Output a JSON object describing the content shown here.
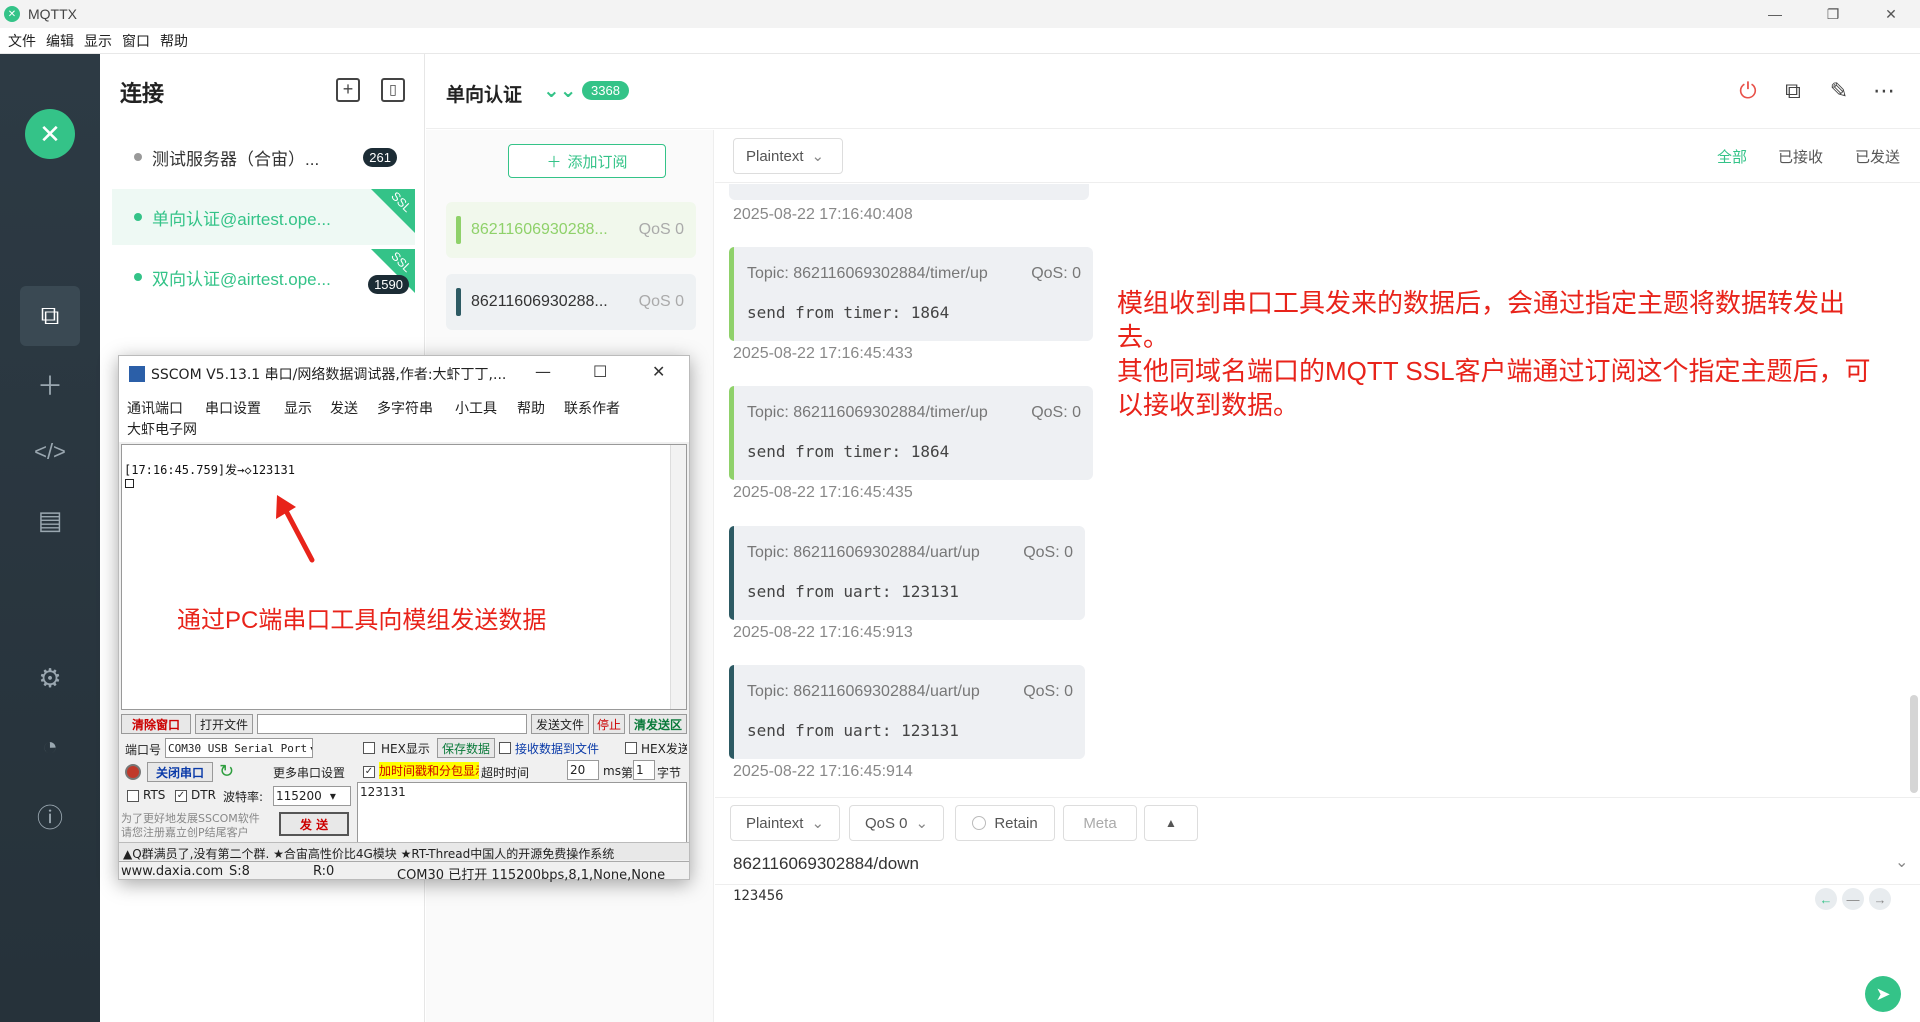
{
  "window": {
    "title": "MQTTX"
  },
  "menubar": [
    "文件",
    "编辑",
    "显示",
    "窗口",
    "帮助"
  ],
  "sidebar_nav": [
    {
      "icon": "connections-icon",
      "active": true
    },
    {
      "icon": "plus-icon",
      "active": false
    },
    {
      "icon": "script-icon",
      "active": false
    },
    {
      "icon": "log-icon",
      "active": false
    },
    {
      "icon": "settings-icon",
      "active": false
    },
    {
      "icon": "subscribe-feed-icon",
      "active": false
    },
    {
      "icon": "about-icon",
      "active": false
    }
  ],
  "connections": {
    "title": "连接",
    "items": [
      {
        "name": "测试服务器（合宙）...",
        "badge": "261",
        "ssl": false,
        "connected": false,
        "active": false
      },
      {
        "name": "单向认证@airtest.ope...",
        "badge": "",
        "ssl": true,
        "connected": true,
        "active": true
      },
      {
        "name": "双向认证@airtest.ope...",
        "badge": "1590",
        "ssl": true,
        "connected": true,
        "active": false
      }
    ],
    "ssl_label": "SSL"
  },
  "header": {
    "title": "单向认证",
    "badge": "3368"
  },
  "topics": {
    "add_label": "添加订阅",
    "items": [
      {
        "topic": "86211606930288...",
        "qos": "QoS 0",
        "color": "#8fd16a"
      },
      {
        "topic": "86211606930288...",
        "qos": "QoS 0",
        "color": "#2d5a63"
      }
    ]
  },
  "message_toolbar": {
    "format": "Plaintext",
    "filters": [
      "全部",
      "已接收",
      "已发送"
    ]
  },
  "messages": [
    {
      "timestamp": "2025-08-22 17:16:40:408"
    },
    {
      "topic": "Topic: 862116069302884/timer/up",
      "qos": "QoS: 0",
      "payload": "send from timer: 1864",
      "timestamp": "2025-08-22 17:16:45:433",
      "color": "#8fd16a"
    },
    {
      "topic": "Topic: 862116069302884/timer/up",
      "qos": "QoS: 0",
      "payload": "send from timer: 1864",
      "timestamp": "2025-08-22 17:16:45:435",
      "color": "#8fd16a"
    },
    {
      "topic": "Topic: 862116069302884/uart/up",
      "qos": "QoS: 0",
      "payload": "send from uart: 123131",
      "timestamp": "2025-08-22 17:16:45:913",
      "color": "#2d5a63"
    },
    {
      "topic": "Topic: 862116069302884/uart/up",
      "qos": "QoS: 0",
      "payload": "send from uart: 123131",
      "timestamp": "2025-08-22 17:16:45:914",
      "color": "#2d5a63"
    }
  ],
  "annotation": {
    "line1": "模组收到串口工具发来的数据后，会通过指定主题将数据转发出",
    "line2": "去。",
    "line3": "其他同域名端口的MQTT SSL客户端通过订阅这个指定主题后，可",
    "line4": "以接收到数据。"
  },
  "publish": {
    "format": "Plaintext",
    "qos": "QoS 0",
    "retain": "Retain",
    "meta": "Meta",
    "topic": "862116069302884/down",
    "payload": "123456"
  },
  "sscom": {
    "title": "SSCOM V5.13.1 串口/网络数据调试器,作者:大虾丁丁,...",
    "menu": [
      "通讯端口",
      "串口设置",
      "显示",
      "发送",
      "多字符串",
      "小工具",
      "帮助",
      "联系作者",
      "大虾电子网"
    ],
    "recv_line": "[17:16:45.759]发→◇123131",
    "annotation": "通过PC端串口工具向模组发送数据",
    "buttons": {
      "clear": "清除窗口",
      "open_file": "打开文件",
      "send_file": "发送文件",
      "stop": "停止",
      "clear_send": "清发送区",
      "close_port": "关闭串口",
      "more_settings": "更多串口设置",
      "save_data": "保存数据",
      "send": "发 送"
    },
    "labels": {
      "port": "端口号",
      "port_value": "COM30 USB Serial Port",
      "hex_display": "HEX显示",
      "recv_to_file": "接收数据到文件",
      "hex_send": "HEX发送",
      "timestamp": "加时间戳和分包显示,",
      "timeout": "超时时间",
      "timeout_value": "20",
      "ms": "ms",
      "nth": "第",
      "nth_value": "1",
      "byte": "字节",
      "rts": "RTS",
      "dtr": "DTR",
      "baud_label": "波特率:",
      "baud_value": "115200",
      "send_data": "123131",
      "promo1": "为了更好地发展SSCOM软件",
      "promo2": "请您注册嘉立创P结尾客户",
      "ticker": "▲Q群满员了,没有第二个群.   ★合宙高性价比4G模块   ★RT-Thread中国人的开源免费操作系统"
    },
    "status": {
      "site": "www.daxia.com",
      "s": "S:8",
      "r": "R:0",
      "port_state": "COM30 已打开  115200bps,8,1,None,None"
    }
  }
}
